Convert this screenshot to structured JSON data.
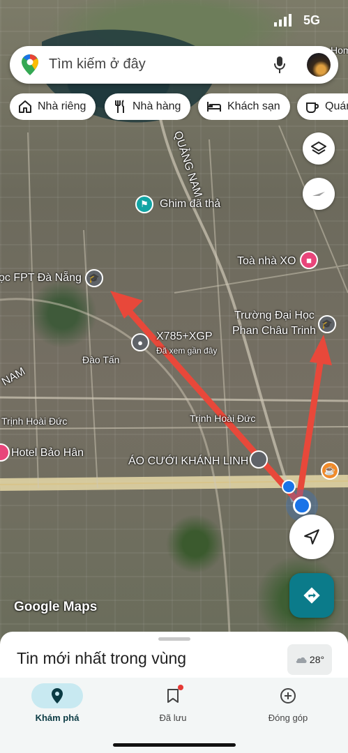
{
  "status_bar": {
    "signal_icon": "cellular-signal-icon",
    "network": "5G"
  },
  "search": {
    "placeholder": "Tìm kiếm ở đây"
  },
  "chips": [
    {
      "label": "Nhà riêng",
      "icon": "home-icon"
    },
    {
      "label": "Nhà hàng",
      "icon": "restaurant-icon"
    },
    {
      "label": "Khách sạn",
      "icon": "bed-icon"
    },
    {
      "label": "Quán",
      "icon": "cafe-icon"
    }
  ],
  "map": {
    "labels": {
      "dropped_pin": "Ghim đã thả",
      "fpt": "ọc FPT Đà Nẵng",
      "toa_nha": "Toà nhà XO",
      "truong1": "Trường Đại Học",
      "truong2": "Phan Châu Trinh",
      "pluscode": "X785+XGP",
      "recent": "Đã xem gần đây",
      "dao_tan": "Đào Tấn",
      "nam": "NAM",
      "trinh1": "Trịnh Hoài Đức",
      "trinh2": "Trịnh Hoài Đức",
      "hotel": "Hotel Bảo Hân",
      "ao_cuoi": "ÁO CƯỚI KHÁNH LINH",
      "quang_nam": "QUẢNG NAM",
      "hom": "Hom",
      "watermark": "Google Maps"
    },
    "colors": {
      "arrow": "#e8483a",
      "location": "#1a73e8",
      "directions": "#0b7b8a",
      "pin_green": "#12a4a4",
      "pin_pink": "#e8457a"
    }
  },
  "panel": {
    "title": "Tin mới nhất trong vùng",
    "weather": "28°"
  },
  "nav": [
    {
      "label": "Khám phá",
      "icon": "explore-pin-icon",
      "active": true
    },
    {
      "label": "Đã lưu",
      "icon": "bookmark-icon",
      "active": false
    },
    {
      "label": "Đóng góp",
      "icon": "add-circle-icon",
      "active": false
    }
  ]
}
